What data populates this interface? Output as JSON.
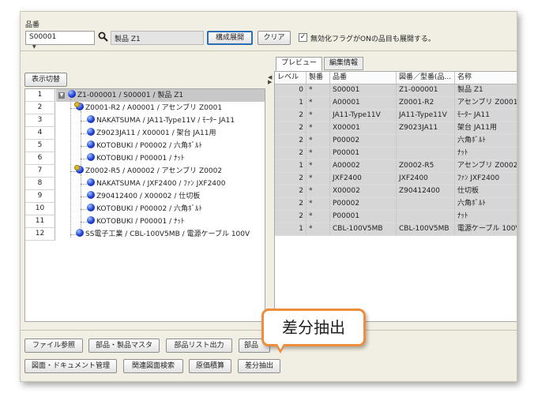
{
  "header": {
    "field_label": "品番",
    "part_number_value": "S00001",
    "part_name_value": "製品 Z1",
    "expand_button": "構成展開",
    "clear_button": "クリア",
    "invalid_flag_checked": true,
    "invalid_flag_label": "無効化フラグがONの品目も展開する。"
  },
  "display_toggle": "表示切替",
  "tree": {
    "rows": [
      {
        "num": "1",
        "label": "Z1-000001 / S00001 / 製品 Z1"
      },
      {
        "num": "2",
        "label": "Z0001-R2 / A00001 / アセンブリ Z0001"
      },
      {
        "num": "3",
        "label": "NAKATSUMA / JA11-Type11V / ﾓｰﾀｰ JA11"
      },
      {
        "num": "4",
        "label": "Z9023JA11 / X00001 / 架台 JA11用"
      },
      {
        "num": "5",
        "label": "KOTOBUKI / P00002 / 六角ﾎﾞﾙﾄ"
      },
      {
        "num": "6",
        "label": "KOTOBUKI / P00001 / ﾅｯﾄ"
      },
      {
        "num": "7",
        "label": "Z0002-R5 / A00002 / アセンブリ Z0002"
      },
      {
        "num": "8",
        "label": "NAKATSUMA / JXF2400 / ﾌｧﾝ JXF2400"
      },
      {
        "num": "9",
        "label": "Z90412400 / X00002 / 仕切板"
      },
      {
        "num": "10",
        "label": "KOTOBUKI / P00002 / 六角ﾎﾞﾙﾄ"
      },
      {
        "num": "11",
        "label": "KOTOBUKI / P00001 / ﾅｯﾄ"
      },
      {
        "num": "12",
        "label": "SS電子工業 / CBL-100V5MB / 電源ケーブル 100V"
      }
    ]
  },
  "tabs": [
    "プレビュー",
    "編集情報"
  ],
  "grid": {
    "headers": [
      "レベル",
      "製番",
      "品番",
      "図番／型番(品...",
      "名称"
    ],
    "rows": [
      [
        "0",
        "*",
        "S00001",
        "Z1-000001",
        "製品 Z1"
      ],
      [
        "1",
        "*",
        "A00001",
        "Z0001-R2",
        "アセンブリ Z0001"
      ],
      [
        "2",
        "*",
        "JA11-Type11V",
        "JA11-Type11V",
        "ﾓｰﾀｰ JA11"
      ],
      [
        "2",
        "*",
        "X00001",
        "Z9023JA11",
        "架台 JA11用"
      ],
      [
        "2",
        "*",
        "P00002",
        "",
        "六角ﾎﾞﾙﾄ"
      ],
      [
        "2",
        "*",
        "P00001",
        "",
        "ﾅｯﾄ"
      ],
      [
        "1",
        "*",
        "A00002",
        "Z0002-R5",
        "アセンブリ Z0002"
      ],
      [
        "2",
        "*",
        "JXF2400",
        "JXF2400",
        "ﾌｧﾝ JXF2400"
      ],
      [
        "2",
        "*",
        "X00002",
        "Z90412400",
        "仕切板"
      ],
      [
        "2",
        "*",
        "P00002",
        "",
        "六角ﾎﾞﾙﾄ"
      ],
      [
        "2",
        "*",
        "P00001",
        "",
        "ﾅｯﾄ"
      ],
      [
        "1",
        "*",
        "CBL-100V5MB",
        "CBL-100V5MB",
        "電源ケーブル 100V"
      ]
    ]
  },
  "bottom_buttons": {
    "file_ref": "ファイル参照",
    "part_master": "部品・製品マスタ",
    "part_list": "部品リスト出力",
    "part_truncated": "部品",
    "doc_mgmt": "図面・ドキュメント管理",
    "related_search": "関連図面検索",
    "cost_estimate": "原価積算",
    "diff_extract": "差分抽出"
  },
  "callout": "差分抽出",
  "colors": {
    "window_bg": "#f1efe4",
    "selected_row": "#c8c8c8",
    "callout_border": "#ee8d3b",
    "active_button_border": "#2a6eb6"
  }
}
